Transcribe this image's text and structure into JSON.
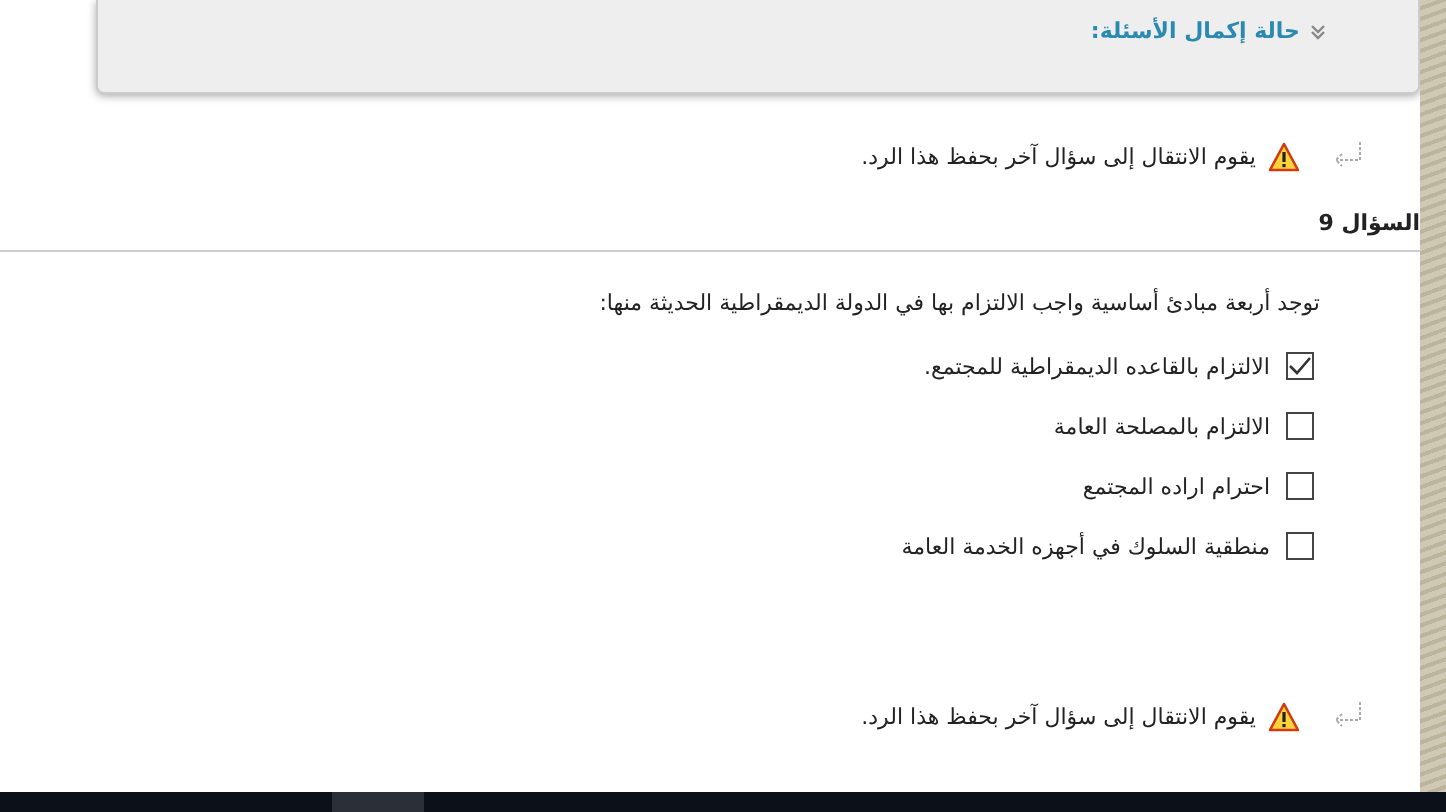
{
  "status_panel": {
    "title": "حالة إكمال الأسئلة:",
    "expanded": false
  },
  "save_notice_top": "يقوم الانتقال إلى سؤال آخر بحفظ هذا الرد.",
  "question": {
    "title": "السؤال 9",
    "prompt": "توجد أربعة مبادئ أساسية واجب الالتزام بها في الدولة الديمقراطية الحديثة منها:",
    "options": [
      {
        "label": "الالتزام بالقاعده الديمقراطية للمجتمع.",
        "checked": true
      },
      {
        "label": "الالتزام بالمصلحة العامة",
        "checked": false
      },
      {
        "label": "احترام اراده المجتمع",
        "checked": false
      },
      {
        "label": "منطقية السلوك في أجهزه الخدمة العامة",
        "checked": false
      }
    ]
  },
  "save_notice_bottom": "يقوم الانتقال إلى سؤال آخر بحفظ هذا الرد."
}
